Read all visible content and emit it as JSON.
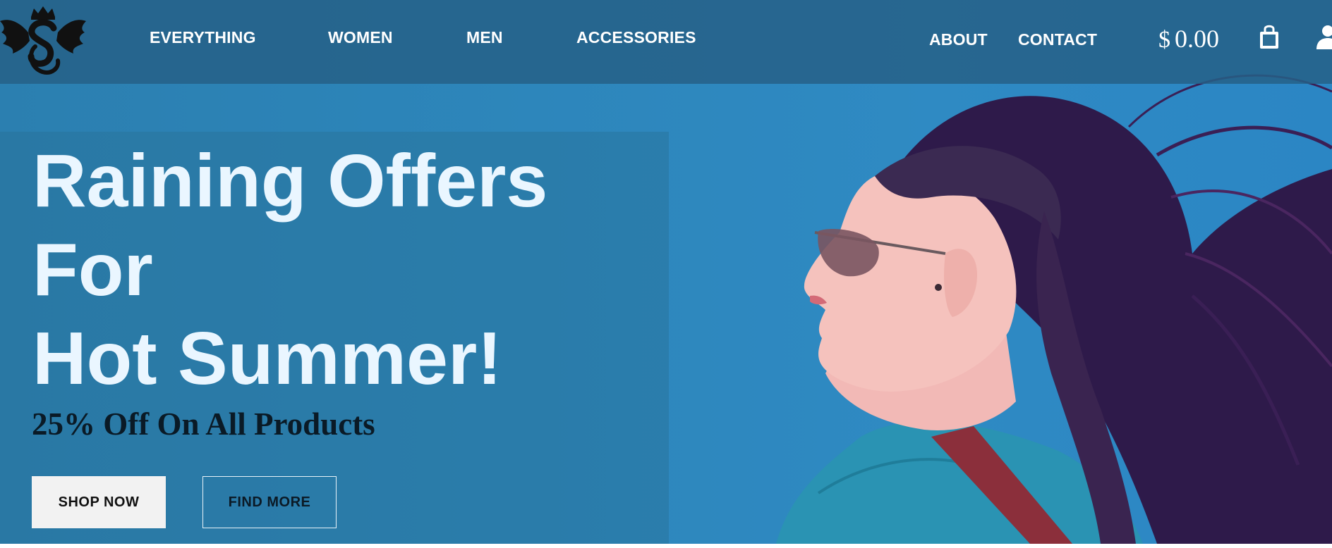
{
  "header": {
    "nav_left": [
      "EVERYTHING",
      "WOMEN",
      "MEN",
      "ACCESSORIES"
    ],
    "nav_right": [
      "ABOUT",
      "CONTACT"
    ],
    "cart": {
      "currency": "$",
      "amount": "0.00"
    },
    "icons": {
      "logo": "winged-s-crest-logo",
      "cart": "shopping-bag-icon",
      "account": "user-icon"
    }
  },
  "hero": {
    "headline": [
      "Raining Offers",
      "For",
      "Hot Summer!"
    ],
    "subheadline": "25% Off On All Products",
    "primary_button": "SHOP NOW",
    "secondary_button": "FIND MORE"
  },
  "colors": {
    "hero_background": "#2d86bb",
    "header_overlay": "#266087",
    "headline_text": "#eaf6ff",
    "subheadline_text": "#0a1a26",
    "primary_button_bg": "#f2f2f2"
  }
}
